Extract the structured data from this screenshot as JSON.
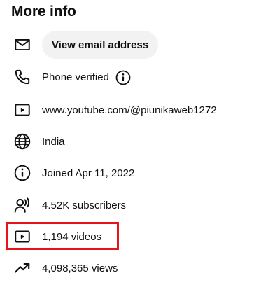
{
  "section": {
    "title": "More info"
  },
  "email": {
    "button_label": "View email address",
    "icon": "mail-icon"
  },
  "phone": {
    "label": "Phone verified",
    "icon": "phone-icon",
    "info_icon": "info-icon"
  },
  "channel_link": {
    "label": "www.youtube.com/@piunikaweb1272",
    "icon": "play-box-icon"
  },
  "country": {
    "label": "India",
    "icon": "globe-icon"
  },
  "joined": {
    "label": "Joined Apr 11, 2022",
    "icon": "info-icon"
  },
  "subscribers": {
    "label": "4.52K subscribers",
    "icon": "person-broadcast-icon"
  },
  "videos": {
    "label": "1,194 videos",
    "icon": "play-box-icon",
    "highlight_color": "#e8141c"
  },
  "views": {
    "label": "4,098,365 views",
    "icon": "trending-up-icon"
  }
}
